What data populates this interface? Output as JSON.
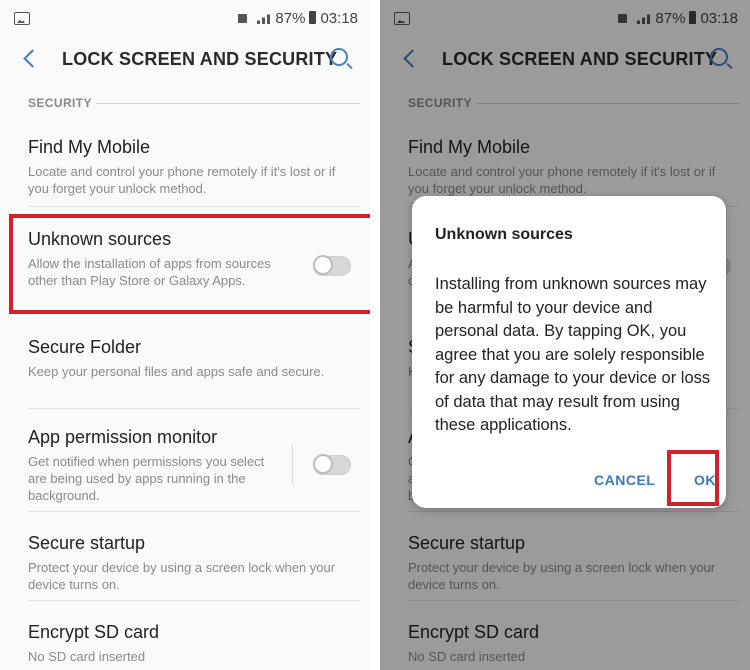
{
  "status": {
    "battery": "87%",
    "time": "03:18"
  },
  "header": {
    "title": "LOCK SCREEN AND SECURITY"
  },
  "section": "SECURITY",
  "items": [
    {
      "title": "Find My Mobile",
      "desc": "Locate and control your phone remotely if it's lost or if you forget your unlock method.",
      "toggle": null
    },
    {
      "title": "Unknown sources",
      "desc": "Allow the installation of apps from sources other than Play Store or Galaxy Apps.",
      "toggle": false
    },
    {
      "title": "Secure Folder",
      "desc": "Keep your personal files and apps safe and secure.",
      "toggle": null
    },
    {
      "title": "App permission monitor",
      "desc": "Get notified when permissions you select are being used by apps running in the background.",
      "toggle": false
    },
    {
      "title": "Secure startup",
      "desc": "Protect your device by using a screen lock when your device turns on.",
      "toggle": null
    },
    {
      "title": "Encrypt SD card",
      "desc": "No SD card inserted",
      "toggle": null
    }
  ],
  "dialog": {
    "title": "Unknown sources",
    "body": "Installing from unknown sources may be harmful to your device and personal data. By tapping OK, you agree that you are solely responsible for any damage to your device or loss of data that may result from using these applications.",
    "cancel": "CANCEL",
    "ok": "OK"
  },
  "colors": {
    "accent": "#3a78c0",
    "highlight": "#d3212a"
  }
}
